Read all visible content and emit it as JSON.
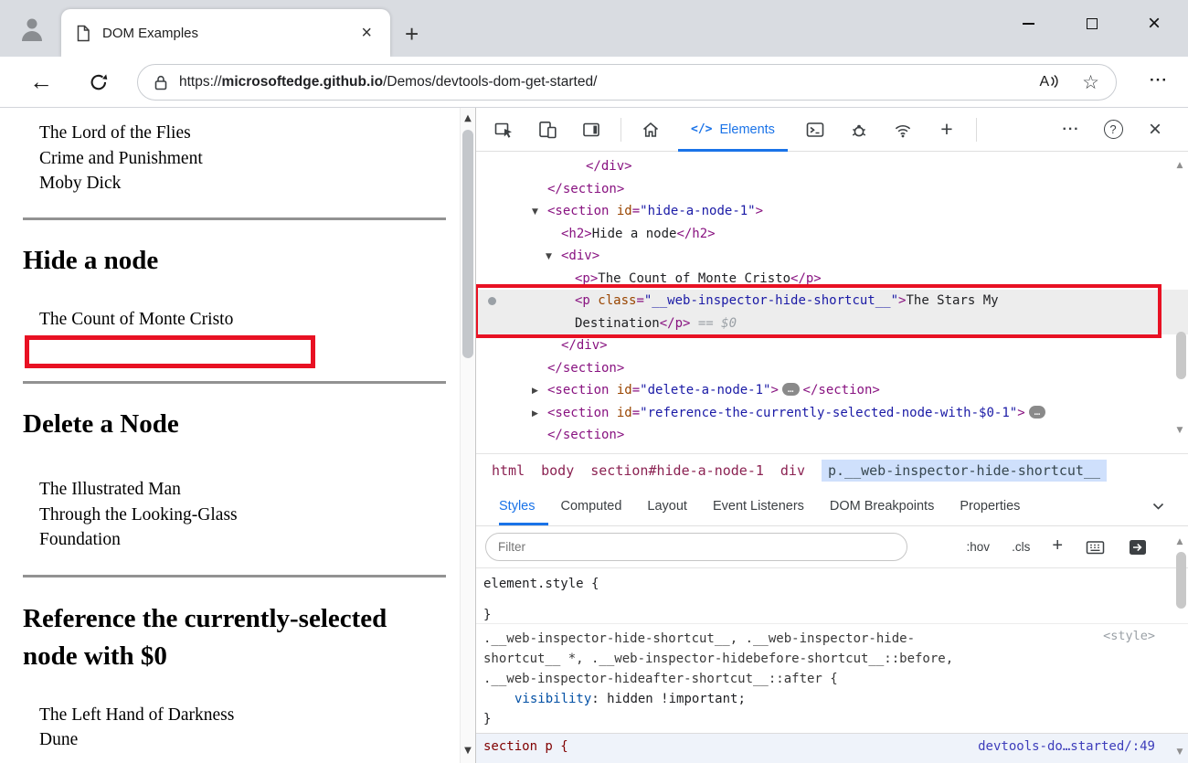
{
  "colors": {
    "accent": "#1a73e8",
    "annotation_red": "#e81123",
    "selected_crumb_bg": "#cfe0fc"
  },
  "icons": {
    "close": "×",
    "plus": "+",
    "back": "←",
    "star": "☆",
    "more": "···",
    "help": "?",
    "read_aloud": "A",
    "up_arrow": "▲",
    "down_arrow": "▼"
  },
  "titlebar": {
    "tab_title": "DOM Examples"
  },
  "address_bar": {
    "scheme": "https://",
    "domain": "microsoftedge.github.io",
    "path": "/Demos/devtools-dom-get-started/"
  },
  "page": {
    "intro_books": [
      "The Lord of the Flies",
      "Crime and Punishment",
      "Moby Dick"
    ],
    "hide_section": {
      "heading": "Hide a node",
      "books": [
        "The Count of Monte Cristo"
      ]
    },
    "delete_section": {
      "heading": "Delete a Node",
      "books": [
        "The Illustrated Man",
        "Through the Looking-Glass",
        "Foundation"
      ]
    },
    "reference_section": {
      "heading": "Reference the currently-selected node with $0",
      "books": [
        "The Left Hand of Darkness",
        "Dune"
      ]
    }
  },
  "devtools": {
    "toolbar": {
      "elements_icon": "</>",
      "elements_label": "Elements"
    },
    "dom_tree": {
      "lines": [
        {
          "indent": 120,
          "segs": [
            [
              "tag",
              "</div>"
            ]
          ]
        },
        {
          "indent": 78,
          "segs": [
            [
              "tag",
              "</section>"
            ]
          ]
        },
        {
          "indent": 78,
          "arrow": "▼",
          "segs": [
            [
              "tag",
              "<section"
            ],
            [
              "attr",
              " id"
            ],
            [
              "tag",
              "="
            ],
            [
              "val",
              "\"hide-a-node-1\""
            ],
            [
              "tag",
              ">"
            ]
          ]
        },
        {
          "indent": 93,
          "segs": [
            [
              "tag",
              "<h2>"
            ],
            [
              "text",
              "Hide a node"
            ],
            [
              "tag",
              "</h2>"
            ]
          ]
        },
        {
          "indent": 93,
          "arrow": "▼",
          "segs": [
            [
              "tag",
              "<div>"
            ]
          ]
        },
        {
          "indent": 108,
          "segs": [
            [
              "tag",
              "<p>"
            ],
            [
              "text",
              "The Count of Monte Cristo"
            ],
            [
              "tag",
              "</p>"
            ]
          ]
        },
        {
          "indent": 108,
          "selected": true,
          "dot": true,
          "segs": [
            [
              "tag",
              "<p"
            ],
            [
              "attr",
              " class"
            ],
            [
              "tag",
              "="
            ],
            [
              "val",
              "\"__web-inspector-hide-shortcut__\""
            ],
            [
              "tag",
              ">"
            ],
            [
              "text",
              "The Stars My"
            ]
          ]
        },
        {
          "indent": 108,
          "selected": true,
          "segs": [
            [
              "text",
              "Destination"
            ],
            [
              "tag",
              "</p>"
            ],
            [
              "dim",
              " == $0"
            ]
          ]
        },
        {
          "indent": 93,
          "segs": [
            [
              "tag",
              "</div>"
            ]
          ]
        },
        {
          "indent": 78,
          "segs": [
            [
              "tag",
              "</section>"
            ]
          ]
        },
        {
          "indent": 78,
          "arrow": "▶",
          "segs": [
            [
              "tag",
              "<section"
            ],
            [
              "attr",
              " id"
            ],
            [
              "tag",
              "="
            ],
            [
              "val",
              "\"delete-a-node-1\""
            ],
            [
              "tag",
              ">"
            ],
            [
              "pill",
              "…"
            ],
            [
              "tag",
              "</section>"
            ]
          ]
        },
        {
          "indent": 78,
          "arrow": "▶",
          "segs": [
            [
              "tag",
              "<section"
            ],
            [
              "attr",
              " id"
            ],
            [
              "tag",
              "="
            ],
            [
              "val",
              "\"reference-the-currently-selected-node-with-$0-1\""
            ],
            [
              "tag",
              ">"
            ],
            [
              "pill",
              "…"
            ]
          ]
        },
        {
          "indent": 78,
          "segs": [
            [
              "tag",
              "</section>"
            ]
          ]
        }
      ]
    },
    "breadcrumbs": [
      "html",
      "body",
      "section#hide-a-node-1",
      "div",
      "p.__web-inspector-hide-shortcut__"
    ],
    "panel_tabs": [
      "Styles",
      "Computed",
      "Layout",
      "Event Listeners",
      "DOM Breakpoints",
      "Properties"
    ],
    "filter": {
      "placeholder": "Filter",
      "hov_label": ":hov",
      "cls_label": ".cls",
      "plus_label": "+"
    },
    "styles": {
      "inline_rule_open": "element.style {",
      "inline_rule_close": "}",
      "rule_selector_lines": [
        ".__web-inspector-hide-shortcut__, .__web-inspector-hide-",
        "shortcut__ *, .__web-inspector-hidebefore-shortcut__::before,",
        ".__web-inspector-hideafter-shortcut__::after {"
      ],
      "rule_source": "<style>",
      "declaration_property": "visibility",
      "declaration_rest": ": hidden !important;",
      "rule_close": "}",
      "next_rule_selector": "section p {",
      "next_rule_source": "devtools-do…started/:49"
    }
  }
}
